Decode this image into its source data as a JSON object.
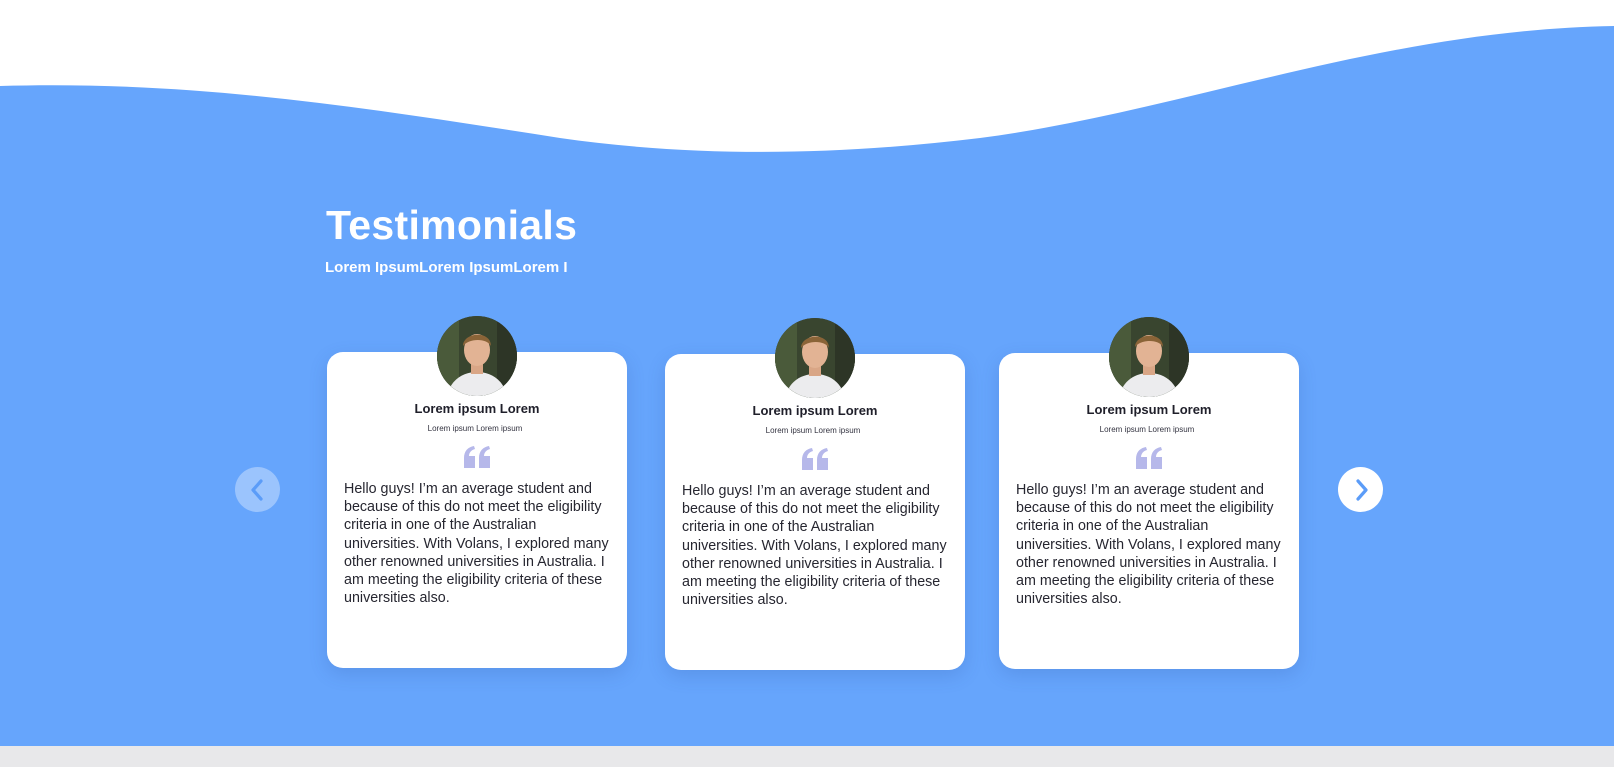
{
  "section": {
    "title": "Testimonials",
    "subtitle": "Lorem IpsumLorem IpsumLorem I"
  },
  "colors": {
    "background_blue": "#66a5fc",
    "card": "#ffffff",
    "quote_icon": "#b6b8ea",
    "arrow_icon": "#5b9cf8"
  },
  "navigation": {
    "prev_icon": "chevron-left-icon",
    "next_icon": "chevron-right-icon"
  },
  "testimonials": [
    {
      "name": "Lorem ipsum Lorem",
      "role": "Lorem ipsum Lorem ipsum",
      "text": "Hello guys! I’m an average student and because of this do not meet the eligibility criteria in one of the Australian universities. With Volans, I explored many other renowned universities in Australia. I am meeting the eligibility criteria of these universities also."
    },
    {
      "name": "Lorem ipsum Lorem",
      "role": "Lorem ipsum Lorem ipsum",
      "text": "Hello guys! I’m an average student and because of this do not meet the eligibility criteria in one of the Australian universities. With Volans, I explored many other renowned universities in Australia. I am meeting the eligibility criteria of these universities also."
    },
    {
      "name": "Lorem ipsum Lorem",
      "role": "Lorem ipsum Lorem ipsum",
      "text": "Hello guys! I’m an average student and because of this do not meet the eligibility criteria in one of the Australian universities. With Volans, I explored many other renowned universities in Australia. I am meeting the eligibility criteria of these universities also."
    }
  ]
}
